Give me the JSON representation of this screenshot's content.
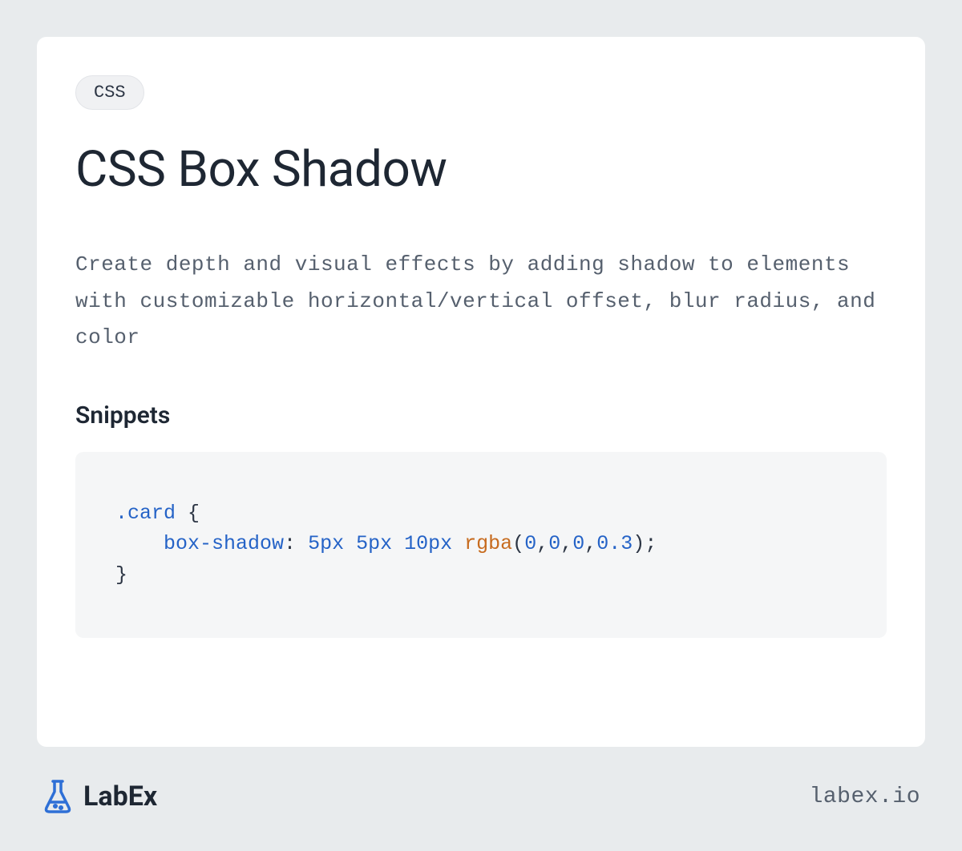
{
  "tag": "CSS",
  "title": "CSS Box Shadow",
  "description": "Create depth and visual effects by adding shadow to elements with customizable horizontal/vertical offset, blur radius, and color",
  "snippets_heading": "Snippets",
  "code": {
    "selector": ".card",
    "brace_open": " {",
    "indent": "    ",
    "property": "box-shadow",
    "colon": ": ",
    "val1": "5px",
    "sp": " ",
    "val2": "5px",
    "val3": "10px",
    "func": "rgba",
    "paren_open": "(",
    "n0a": "0",
    "comma": ",",
    "n0b": "0",
    "n0c": "0",
    "alpha": "0.3",
    "paren_close": ")",
    "semi": ";",
    "brace_close": "}"
  },
  "brand": {
    "name": "LabEx",
    "domain": "labex.io",
    "icon_color": "#2e6fd6"
  }
}
